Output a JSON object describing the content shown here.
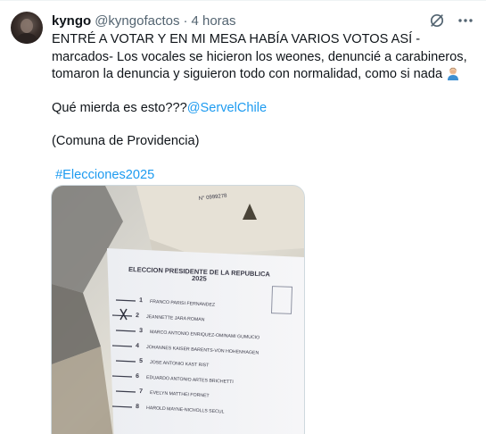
{
  "tweet": {
    "display_name": "kyngo",
    "handle": "@kyngofactos",
    "separator": "·",
    "time": "4 horas",
    "text_line1": "ENTRÉ A VOTAR Y EN MI MESA HABÍA VARIOS VOTOS ASÍ -marcados- Los vocales se hicieron los weones, denuncié a carabineros, tomaron la denuncia y siguieron todo con normalidad, como si nada",
    "text_question": "Qué mierda es esto???",
    "mention": "@ServelChile",
    "text_comuna": "(Comuna de Providencia)",
    "hashtag": "#Elecciones2025",
    "emoji": "man-facepalming-emoji"
  },
  "icons": {
    "grok": "grok-icon",
    "more": "more-icon"
  },
  "ballot": {
    "serial": "N° 0999278",
    "title_line1": "ELECCION PRESIDENTE DE LA REPUBLICA",
    "title_line2": "2025",
    "candidates": [
      {
        "number": "1",
        "name": "FRANCO PARISI FERNANDEZ"
      },
      {
        "number": "2",
        "name": "JEANNETTE JARA ROMAN"
      },
      {
        "number": "3",
        "name": "MARCO ANTONIO ENRIQUEZ-OMINAMI GUMUCIO"
      },
      {
        "number": "4",
        "name": "JOHANNES KAISER BARENTS-VON HOHENHAGEN"
      },
      {
        "number": "5",
        "name": "JOSE ANTONIO KAST RIST"
      },
      {
        "number": "6",
        "name": "EDUARDO ANTONIO ARTES BRICHETTI"
      },
      {
        "number": "7",
        "name": "EVELYN MATTHEI FORNET"
      },
      {
        "number": "8",
        "name": "HAROLD MAYNE-NICHOLLS SECUL"
      }
    ]
  },
  "colors": {
    "link": "#1d9bf0",
    "secondary_text": "#536471",
    "primary_text": "#0f1419"
  }
}
